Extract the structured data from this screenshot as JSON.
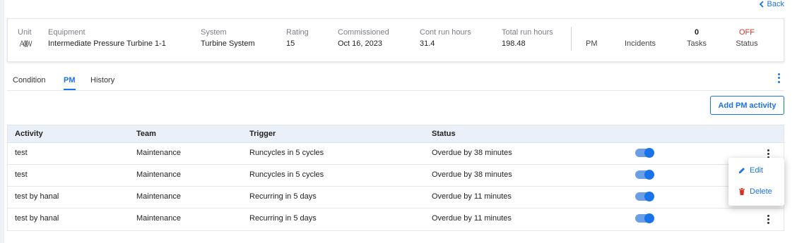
{
  "back": {
    "label": "Back"
  },
  "asset": {
    "unit_label": "Unit",
    "unit_logo": "unit-logo-icon",
    "equipment_label": "Equipment",
    "equipment_value": "Intermediate Pressure Turbine 1-1",
    "system_label": "System",
    "system_value": "Turbine System",
    "rating_label": "Rating",
    "rating_value": "15",
    "commissioned_label": "Commissioned",
    "commissioned_value": "Oct 16, 2023",
    "cont_run_label": "Cont run hours",
    "cont_run_value": "31.4",
    "total_run_label": "Total run hours",
    "total_run_value": "198.48"
  },
  "stats": {
    "pm_label": "PM",
    "incidents_label": "Incidents",
    "tasks_value": "0",
    "tasks_label": "Tasks",
    "status_value": "OFF",
    "status_label": "Status"
  },
  "tabs": [
    {
      "label": "Condition",
      "active": false
    },
    {
      "label": "PM",
      "active": true
    },
    {
      "label": "History",
      "active": false
    }
  ],
  "toolbar": {
    "add_label": "Add PM activity"
  },
  "table": {
    "headers": [
      "Activity",
      "Team",
      "Trigger",
      "Status"
    ],
    "rows": [
      {
        "activity": "test",
        "team": "Maintenance",
        "trigger": "Runcycles in 5 cycles",
        "status": "Overdue by 38 minutes",
        "enabled": true
      },
      {
        "activity": "test",
        "team": "Maintenance",
        "trigger": "Runcycles in 5 cycles",
        "status": "Overdue by 38 minutes",
        "enabled": true
      },
      {
        "activity": "test by hanal",
        "team": "Maintenance",
        "trigger": "Recurring in 5 days",
        "status": "Overdue by 11 minutes",
        "enabled": true
      },
      {
        "activity": "test by hanal",
        "team": "Maintenance",
        "trigger": "Recurring in 5 days",
        "status": "Overdue by 11 minutes",
        "enabled": true
      }
    ]
  },
  "context_menu": {
    "edit_label": "Edit",
    "delete_label": "Delete"
  },
  "colors": {
    "accent": "#1a73e8",
    "status_off": "#d93025",
    "delete_icon": "#d93025",
    "header_bg": "#eaf0f8"
  }
}
